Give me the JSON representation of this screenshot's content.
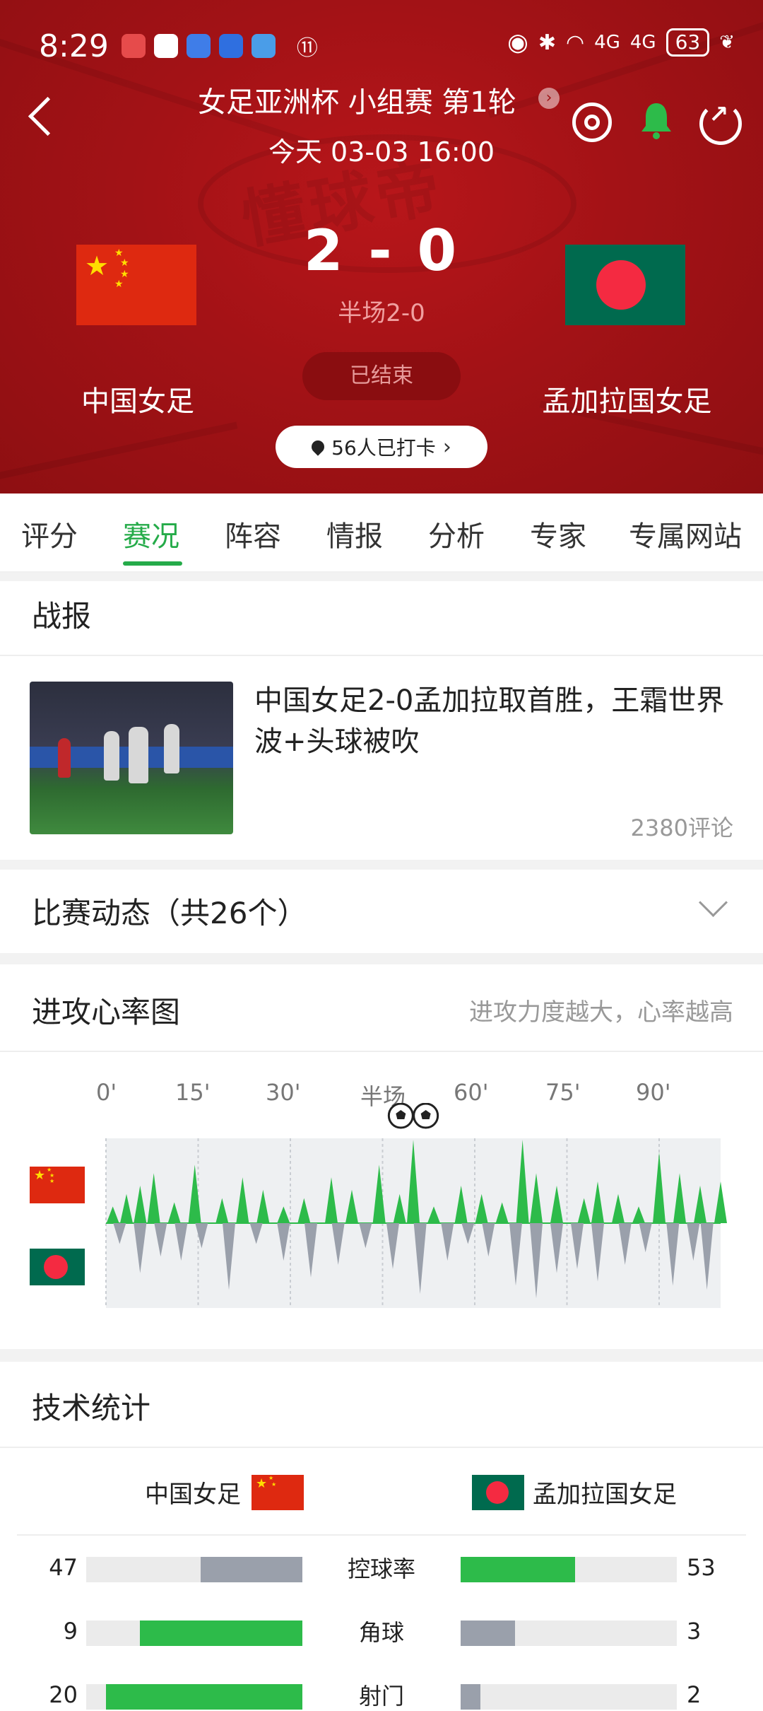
{
  "status_bar": {
    "time": "8:29",
    "battery": "63",
    "network1": "4G",
    "network2": "4G"
  },
  "header": {
    "match_title": "女足亚洲杯 小组赛 第1轮",
    "match_time": "今天 03-03 16:00",
    "score": "2 - 0",
    "half_score": "半场2-0",
    "status": "已结束",
    "home_team": "中国女足",
    "away_team": "孟加拉国女足",
    "checkin": "56人已打卡",
    "watermark": "懂球帝",
    "colors": {
      "bg": "#a31216",
      "accent": "#25ab49"
    }
  },
  "tabs": [
    {
      "label": "评分"
    },
    {
      "label": "赛况",
      "active": true
    },
    {
      "label": "阵容"
    },
    {
      "label": "情报"
    },
    {
      "label": "分析"
    },
    {
      "label": "专家"
    },
    {
      "label": "专属网站"
    }
  ],
  "report": {
    "section_title": "战报",
    "news_title": "中国女足2-0孟加拉取首胜，王霜世界波+头球被吹",
    "comments": "2380评论"
  },
  "events": {
    "title": "比赛动态（共26个）"
  },
  "heart_chart": {
    "title": "进攻心率图",
    "hint": "进攻力度越大，心率越高",
    "axis_labels": [
      "0'",
      "15'",
      "30'",
      "半场",
      "60'",
      "75'",
      "90'"
    ],
    "goal_minutes": [
      44,
      46
    ],
    "goal_icon": "soccer-ball-icon"
  },
  "chart_data": {
    "type": "area",
    "title": "进攻心率图",
    "x_range": [
      0,
      90
    ],
    "x_ticks": [
      "0'",
      "15'",
      "30'",
      "半场",
      "60'",
      "75'",
      "90'"
    ],
    "y_range": [
      0,
      1
    ],
    "series": [
      {
        "team": "home",
        "color": "#2dbb4a",
        "peaks": [
          [
            1,
            0.2
          ],
          [
            3,
            0.35
          ],
          [
            5,
            0.45
          ],
          [
            7,
            0.6
          ],
          [
            10,
            0.25
          ],
          [
            13,
            0.7
          ],
          [
            17,
            0.3
          ],
          [
            20,
            0.55
          ],
          [
            23,
            0.4
          ],
          [
            26,
            0.2
          ],
          [
            29,
            0.3
          ],
          [
            33,
            0.55
          ],
          [
            36,
            0.4
          ],
          [
            40,
            0.7
          ],
          [
            43,
            0.35
          ],
          [
            45,
            1.0
          ],
          [
            48,
            0.2
          ],
          [
            52,
            0.45
          ],
          [
            55,
            0.35
          ],
          [
            58,
            0.25
          ],
          [
            61,
            1.0
          ],
          [
            63,
            0.6
          ],
          [
            66,
            0.45
          ],
          [
            70,
            0.3
          ],
          [
            72,
            0.5
          ],
          [
            75,
            0.35
          ],
          [
            78,
            0.2
          ],
          [
            81,
            0.85
          ],
          [
            84,
            0.6
          ],
          [
            87,
            0.45
          ],
          [
            90,
            0.5
          ]
        ]
      },
      {
        "team": "away",
        "color": "#9aa0ab",
        "peaks": [
          [
            2,
            0.25
          ],
          [
            5,
            0.6
          ],
          [
            8,
            0.4
          ],
          [
            11,
            0.45
          ],
          [
            14,
            0.3
          ],
          [
            18,
            0.8
          ],
          [
            22,
            0.25
          ],
          [
            26,
            0.45
          ],
          [
            30,
            0.65
          ],
          [
            34,
            0.5
          ],
          [
            38,
            0.3
          ],
          [
            42,
            0.55
          ],
          [
            46,
            0.85
          ],
          [
            50,
            0.45
          ],
          [
            53,
            0.25
          ],
          [
            56,
            0.4
          ],
          [
            60,
            0.75
          ],
          [
            63,
            0.9
          ],
          [
            66,
            0.6
          ],
          [
            69,
            0.55
          ],
          [
            72,
            0.7
          ],
          [
            76,
            0.5
          ],
          [
            79,
            0.35
          ],
          [
            83,
            0.75
          ],
          [
            86,
            0.45
          ],
          [
            88,
            0.8
          ]
        ]
      }
    ]
  },
  "tech_stats": {
    "title": "技术统计",
    "home_team": "中国女足",
    "away_team": "孟加拉国女足",
    "rows": [
      {
        "label": "控球率",
        "home": 47,
        "away": 53,
        "home_color": "#9aa0ab",
        "away_color": "#2dbb4a"
      },
      {
        "label": "角球",
        "home": 9,
        "away": 3,
        "home_color": "#2dbb4a",
        "away_color": "#9aa0ab"
      },
      {
        "label": "射门",
        "home": 20,
        "away": 2,
        "home_color": "#2dbb4a",
        "away_color": "#9aa0ab"
      }
    ]
  },
  "icons": [
    "back-icon",
    "target-icon",
    "bell-icon",
    "share-icon",
    "pin-icon",
    "chevron-right-icon",
    "chevron-down-icon",
    "cn-flag-icon",
    "bd-flag-icon"
  ]
}
